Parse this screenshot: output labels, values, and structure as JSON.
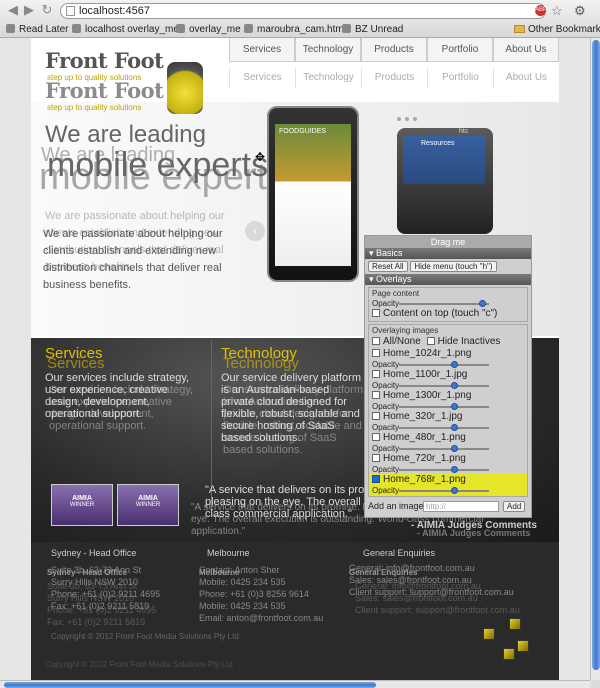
{
  "browser": {
    "url": "localhost:4567",
    "abp_label": "ABP",
    "bookmarks": [
      "Read Later",
      "localhost overlay_me",
      "overlay_me",
      "maroubra_cam.html",
      "BZ Unread"
    ],
    "other_bookmarks": "Other Bookmarks"
  },
  "site": {
    "nav_primary": [
      "Services",
      "Technology",
      "Products",
      "Portfolio",
      "About Us"
    ],
    "nav_overlay": [
      "Services",
      "Technology",
      "Products",
      "Portfolio",
      "About Us"
    ],
    "logo": {
      "brand": "Front Foot",
      "tagline": "step up to quality solutions"
    },
    "hero": {
      "headline_1": "We are leading",
      "headline_2": "mobile experts",
      "body": "We are passionate about helping our clients establish and extending new distribution channels that deliver real business benefits.",
      "body_overlay": "We are passionate about helping our clients establish and extending new distribution channels that deliver real business benefits.",
      "prev": "‹",
      "next": "›"
    },
    "phone_brand": "htc",
    "phone_screen_1": "FOODGUIDES",
    "phone_screen_2": "Resources",
    "services": {
      "title": "Services",
      "body": "Our services include strategy, user experience, creative design, development, operational support."
    },
    "technology": {
      "title": "Technology",
      "body": "Our service delivery platform is an Australian-based private cloud designed for flexible, robust, scalable and secure hosting of SaaS based solutions."
    },
    "quote": {
      "text": "\"A service that delivers on its promise. Easy to navigate and pleasing on the eye. The overall execution is outstanding. World-class commercial application.\"",
      "signature": "- AIMIA Judges Comments"
    },
    "badges": [
      "AIMIA",
      "AIMIA"
    ],
    "badge_sub": "WINNER",
    "footer": {
      "sydney_title": "Sydney - Head Office",
      "sydney_text": "Suite 3b, 63-73 Ann St\nSurry Hills NSW 2010\nPhone: +61 (0)2 9211 4695\nFax: +61 (0)2 9211 5819",
      "melbourne_title": "Melbourne",
      "melbourne_text": "Contact: Anton Sher\nMobile: 0425 234 535\nPhone: +61 (0)3 8256 9614\nMobile: 0425 234 535\nEmail: anton@frontfoot.com.au",
      "enquiries_title": "General Enquiries",
      "enquiries_text": "General: info@frontfoot.com.au\nSales: sales@frontfoot.com.au\nClient support: support@frontfoot.com.au",
      "copyright": "Copyright © 2012 Front Foot Media Solutions Pty Ltd"
    }
  },
  "overlay_panel": {
    "drag_label": "Drag me",
    "basics_label": "Basics",
    "reset_label": "Reset All",
    "hide_label": "Hide menu (touch \"h\")",
    "overlays_label": "Overlays",
    "page_content_label": "Page content",
    "opacity_label": "Opacity",
    "content_on_top_label": "Content on top (touch \"c\")",
    "overlaying_images_label": "Overlaying images",
    "all_none_label": "All/None",
    "hide_inactives_label": "Hide Inactives",
    "images": [
      {
        "name": "Home_1024r_1.png",
        "checked": false,
        "opacity": 0.62
      },
      {
        "name": "Home_1100r_1.jpg",
        "checked": false,
        "opacity": 0.62
      },
      {
        "name": "Home_1300r_1.png",
        "checked": false,
        "opacity": 0.62
      },
      {
        "name": "Home_320r_1.jpg",
        "checked": false,
        "opacity": 0.62
      },
      {
        "name": "Home_480r_1.png",
        "checked": false,
        "opacity": 0.62
      },
      {
        "name": "Home_720r_1.png",
        "checked": false,
        "opacity": 0.62
      },
      {
        "name": "Home_768r_1.png",
        "checked": true,
        "opacity": 0.62
      }
    ],
    "add_image_label": "Add an image",
    "add_placeholder": "http://",
    "add_button": "Add"
  }
}
